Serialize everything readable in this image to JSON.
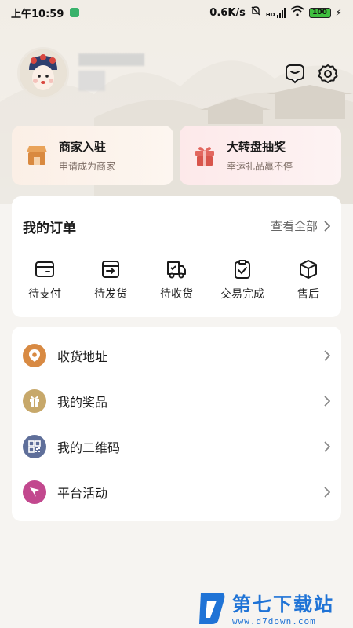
{
  "status_bar": {
    "time": "上午10:59",
    "network_speed": "0.6K/s",
    "signal": "HD",
    "battery": "100"
  },
  "colors": {
    "background": "#f6f4f1",
    "merchant_icon": "#d9893f",
    "lottery_icon": "#d8554c",
    "address_icon": "#d88a43",
    "prize_icon": "#c7a86a",
    "qrcode_icon": "#5f6f9a",
    "activity_icon": "#c2488e",
    "watermark": "#1f73d6"
  },
  "header": {
    "message_icon": "message-icon",
    "settings_icon": "gear-icon"
  },
  "promos": [
    {
      "title": "商家入驻",
      "subtitle": "申请成为商家",
      "icon": "shop-icon"
    },
    {
      "title": "大转盘抽奖",
      "subtitle": "幸运礼品赢不停",
      "icon": "gift-icon"
    }
  ],
  "orders": {
    "title": "我的订单",
    "view_all": "查看全部",
    "items": [
      {
        "label": "待支付",
        "icon": "wallet-icon"
      },
      {
        "label": "待发货",
        "icon": "box-out-icon"
      },
      {
        "label": "待收货",
        "icon": "truck-icon"
      },
      {
        "label": "交易完成",
        "icon": "clipboard-check-icon"
      },
      {
        "label": "售后",
        "icon": "package-icon"
      }
    ]
  },
  "menu": [
    {
      "label": "收货地址",
      "icon": "location-pin-icon"
    },
    {
      "label": "我的奖品",
      "icon": "gift-box-icon"
    },
    {
      "label": "我的二维码",
      "icon": "qrcode-icon"
    },
    {
      "label": "平台活动",
      "icon": "flag-icon"
    }
  ],
  "watermark": {
    "brand": "第七下载站",
    "url": "www.d7down.com"
  }
}
